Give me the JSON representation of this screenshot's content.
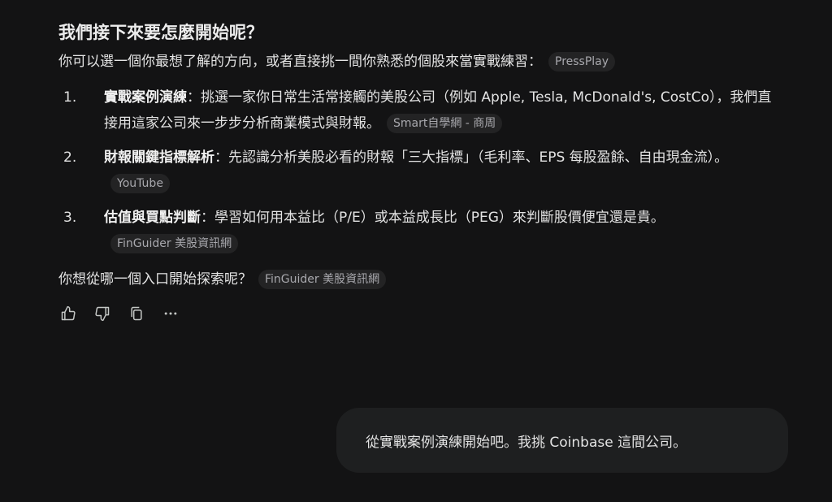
{
  "response": {
    "heading": "我們接下來要怎麼開始呢？",
    "intro": "你可以選一個你最想了解的方向，或者直接挑一間你熟悉的個股來當實戰練習：",
    "intro_source": "PressPlay",
    "steps": [
      {
        "number": "1.",
        "title": "實戰案例演練",
        "text": "：挑選一家你日常生活常接觸的美股公司（例如 Apple, Tesla, McDonald's, CostCo），我們直接用這家公司來一步步分析商業模式與財報。",
        "source": "Smart自學網 - 商周"
      },
      {
        "number": "2.",
        "title": "財報關鍵指標解析",
        "text": "：先認識分析美股必看的財報「三大指標」（毛利率、EPS 每股盈餘、自由現金流）。",
        "source": "YouTube"
      },
      {
        "number": "3.",
        "title": "估值與買點判斷",
        "text": "：學習如何用本益比（P/E）或本益成長比（PEG）來判斷股價便宜還是貴。",
        "source": "FinGuider 美股資訊網"
      }
    ],
    "followup": "你想從哪一個入口開始探索呢？",
    "followup_source": "FinGuider 美股資訊網",
    "actions": [
      "thumbs-up-icon",
      "thumbs-down-icon",
      "copy-icon",
      "more-icon"
    ]
  },
  "user_message": {
    "text": "從實戰案例演練開始吧。我挑 Coinbase 這間公司。"
  },
  "colors": {
    "background": "#131314",
    "text": "#e3e3e3",
    "chip_bg": "#232324",
    "chip_text": "#a8a8ad",
    "bubble_bg": "#1e1f20"
  }
}
